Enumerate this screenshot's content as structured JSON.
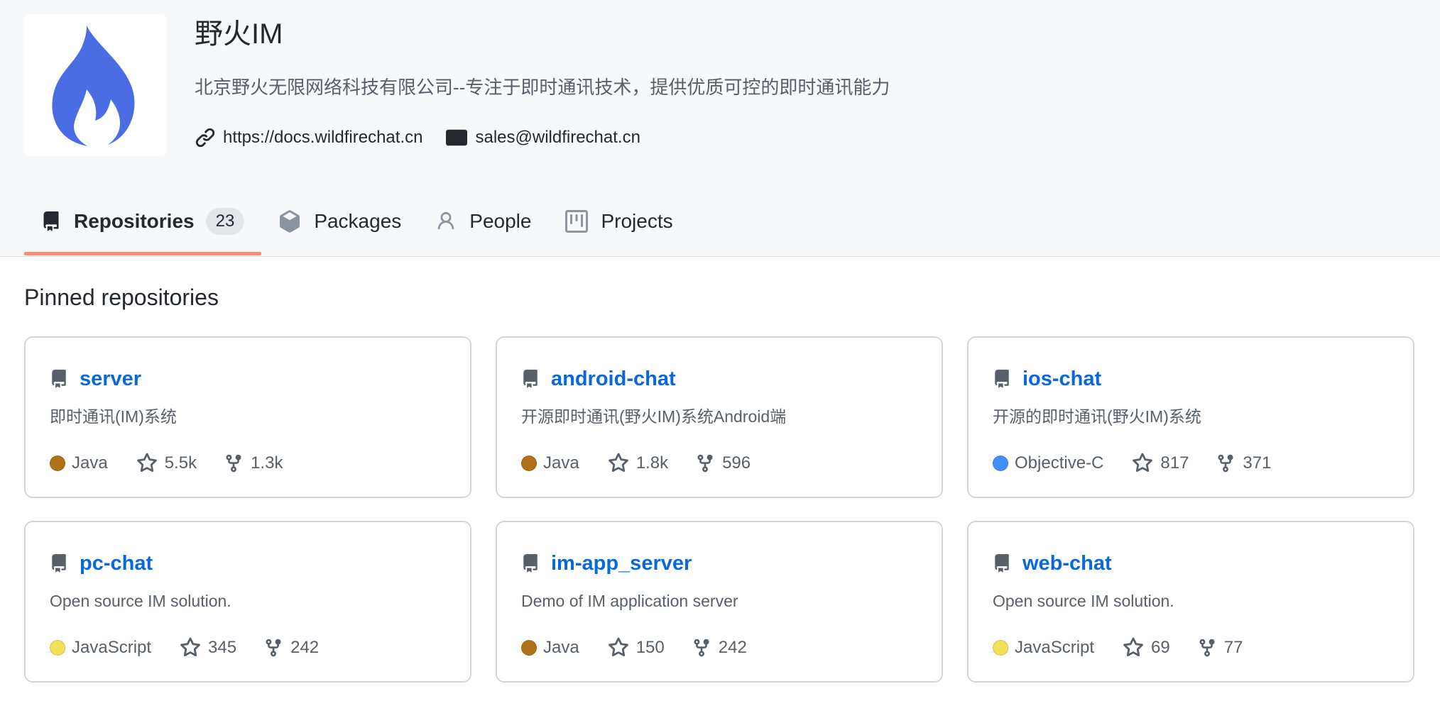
{
  "org": {
    "name": "野火IM",
    "description": "北京野火无限网络科技有限公司--专注于即时通讯技术，提供优质可控的即时通讯能力",
    "website": "https://docs.wildfirechat.cn",
    "email": "sales@wildfirechat.cn",
    "brand_color": "#4a6de3"
  },
  "tabs": [
    {
      "label": "Repositories",
      "count": "23",
      "icon": "repo-icon",
      "selected": true
    },
    {
      "label": "Packages",
      "icon": "package-icon"
    },
    {
      "label": "People",
      "icon": "person-icon"
    },
    {
      "label": "Projects",
      "icon": "project-icon"
    }
  ],
  "pinned": {
    "title": "Pinned repositories",
    "repos": [
      {
        "name": "server",
        "description": "即时通讯(IM)系统",
        "language": "Java",
        "language_color": "#b07219",
        "stars": "5.5k",
        "forks": "1.3k"
      },
      {
        "name": "android-chat",
        "description": "开源即时通讯(野火IM)系统Android端",
        "language": "Java",
        "language_color": "#b07219",
        "stars": "1.8k",
        "forks": "596"
      },
      {
        "name": "ios-chat",
        "description": "开源的即时通讯(野火IM)系统",
        "language": "Objective-C",
        "language_color": "#438eff",
        "stars": "817",
        "forks": "371"
      },
      {
        "name": "pc-chat",
        "description": "Open source IM solution.",
        "language": "JavaScript",
        "language_color": "#f1e05a",
        "stars": "345",
        "forks": "242"
      },
      {
        "name": "im-app_server",
        "description": "Demo of IM application server",
        "language": "Java",
        "language_color": "#b07219",
        "stars": "150",
        "forks": "242"
      },
      {
        "name": "web-chat",
        "description": "Open source IM solution.",
        "language": "JavaScript",
        "language_color": "#f1e05a",
        "stars": "69",
        "forks": "77"
      }
    ]
  }
}
